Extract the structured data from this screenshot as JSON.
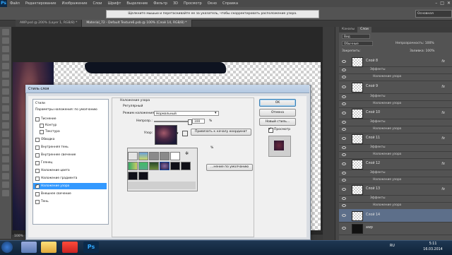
{
  "app": {
    "menu": [
      "Файл",
      "Редактирование",
      "Изображение",
      "Слои",
      "Шрифт",
      "Выделение",
      "Фильтр",
      "3D",
      "Просмотр",
      "Окно",
      "Справка"
    ],
    "hint": "Щелкните мышью и перетаскивайте ее за указатель, чтобы скорректировать расположение узора.",
    "workspace": "Основная",
    "window_controls": [
      "–",
      "□",
      "✕"
    ]
  },
  "tabs": [
    {
      "label": "AWP.psd @ 200% (Layer 1, RGB/8) *",
      "active": false
    },
    {
      "label": "Material_72 - Default Texture6.psb @ 100% (Слой 14, RGB/8) *",
      "active": true
    }
  ],
  "status": {
    "zoom": "100%",
    "doc": "Док: 3,52M/20,8M"
  },
  "layers_panel": {
    "tabs": [
      "Каналы",
      "Слои"
    ],
    "kind": "Вид",
    "blend": "Обычные",
    "opacity_label": "Непрозрачность: 100%",
    "lock_label": "Закрепить:",
    "fill_label": "Заливка: 100%",
    "layers": [
      {
        "name": "Слой 8",
        "effects": "Эффекты",
        "effect": "Наложение узора",
        "fx": "fx"
      },
      {
        "name": "Слой 9",
        "effects": "Эффекты",
        "effect": "Наложение узора",
        "fx": "fx"
      },
      {
        "name": "Слой 10",
        "effects": "Эффекты",
        "effect": "Наложение узора",
        "fx": "fx"
      },
      {
        "name": "Слой 11",
        "effects": "Эффекты",
        "effect": "Наложение узора",
        "fx": "fx"
      },
      {
        "name": "Слой 12",
        "effects": "Эффекты",
        "effect": "Наложение узора",
        "fx": "fx"
      },
      {
        "name": "Слой 13",
        "effects": "Эффекты",
        "effect": "Наложение узора",
        "fx": "fx"
      }
    ],
    "selected_layer": "Слой 14",
    "bottom_layer": "awp"
  },
  "dialog": {
    "title": "Стиль слоя",
    "styles_header": "Стили",
    "blend_options": "Параметры наложения: по умолчанию",
    "items": [
      {
        "label": "Тиснение",
        "checked": false
      },
      {
        "label": "Контур",
        "checked": false
      },
      {
        "label": "Текстура",
        "checked": false
      },
      {
        "label": "Обводка",
        "checked": false
      },
      {
        "label": "Внутренняя тень",
        "checked": false
      },
      {
        "label": "Внутреннее свечение",
        "checked": false
      },
      {
        "label": "Глянец",
        "checked": false
      },
      {
        "label": "Наложение цвета",
        "checked": false
      },
      {
        "label": "Наложение градиента",
        "checked": false
      },
      {
        "label": "Наложение узора",
        "checked": true
      },
      {
        "label": "Внешнее свечение",
        "checked": false
      },
      {
        "label": "Тень",
        "checked": false
      }
    ],
    "section_title": "Наложение узора",
    "section_sub": "Регулярный",
    "blend_mode_label": "Режим наложения:",
    "blend_mode_value": "Нормальный",
    "opacity_label": "Непрозр.:",
    "opacity_value": "100",
    "opacity_unit": "%",
    "pattern_label": "Узор:",
    "snap_button": "Привязать к началу координат",
    "scale_unit": "%",
    "reset_button": "…нение по умолчанию",
    "ok": "OK",
    "cancel": "Отмена",
    "new_style": "Новый стиль...",
    "preview_label": "Просмотр",
    "preview_checked": true
  },
  "taskbar": {
    "lang": "RU",
    "time": "5:11",
    "date": "16.03.2014"
  },
  "colors": {
    "accent": "#3399ff",
    "selected_layer": "#5d6f8a"
  }
}
